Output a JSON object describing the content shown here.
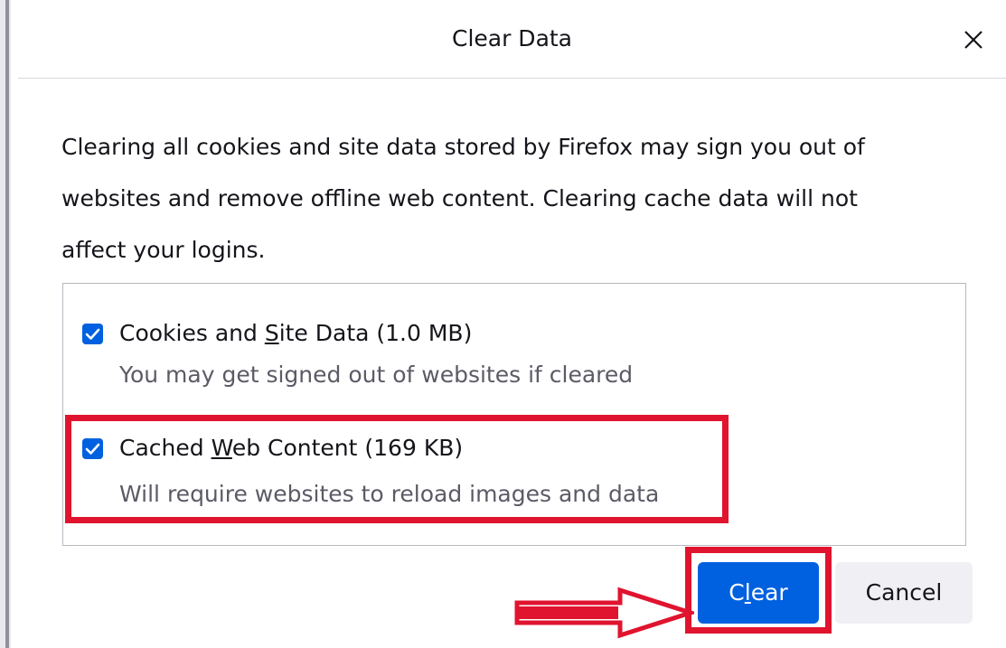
{
  "dialog": {
    "title": "Clear Data",
    "description_lines": [
      "Clearing all cookies and site data stored by Firefox may sign you out of",
      "websites and remove offline web content. Clearing cache data will not",
      "affect your logins."
    ]
  },
  "options": [
    {
      "label_pre": "Cookies and ",
      "label_accesskey": "S",
      "label_post": "ite Data (1.0 MB)",
      "description": "You may get signed out of websites if cleared",
      "checked": true
    },
    {
      "label_pre": "Cached ",
      "label_accesskey": "W",
      "label_post": "eb Content (169 KB)",
      "description": "Will require websites to reload images and data",
      "checked": true
    }
  ],
  "buttons": {
    "clear_pre": "C",
    "clear_accesskey": "l",
    "clear_post": "ear",
    "cancel": "Cancel"
  },
  "colors": {
    "accent": "#0061e0",
    "annotation": "#e0142f"
  },
  "icons": {
    "close": "close-icon",
    "check": "check-icon",
    "arrow": "arrow-right-annotation"
  }
}
